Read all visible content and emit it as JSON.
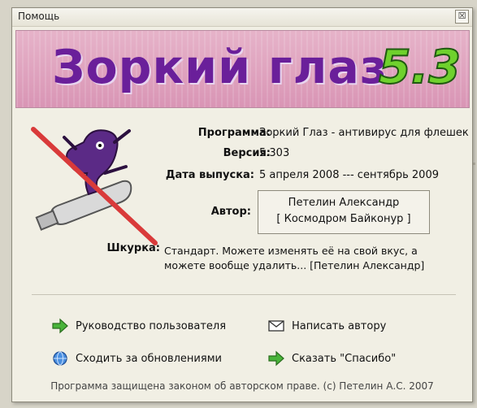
{
  "window": {
    "title": "Помощь",
    "close_glyph": "☒"
  },
  "banner": {
    "title": "Зоркий глаз",
    "version": "5.3"
  },
  "info": {
    "program_label": "Программа:",
    "program_value": "Зоркий Глаз - антивирус для флешек",
    "version_label": "Версия:",
    "version_value": "5.303",
    "release_label": "Дата выпуска:",
    "release_value": "5 апреля 2008  ---  сентябрь 2009",
    "author_label": "Автор:",
    "author_name": "Петелин Александр",
    "author_team": "[ Космодром Байконур ]",
    "skin_label": "Шкурка:",
    "skin_line1": "Стандарт. Можете изменять её на свой вкус, а",
    "skin_line2": "можете вообще удалить... [Петелин Александр]"
  },
  "actions": {
    "manual": "Руководство пользователя",
    "write_author": "Написать автору",
    "updates": "Сходить за обновлениями",
    "thanks": "Сказать \"Спасибо\""
  },
  "footer": {
    "text": "Программа защищена законом об авторском праве. (с) Петелин А.С. 2007"
  },
  "icons": {
    "manual": "green-arrow-icon",
    "write_author": "envelope-icon",
    "updates": "globe-icon",
    "thanks": "green-arrow-icon"
  },
  "colors": {
    "banner_bg": "#d995b5",
    "title_purple": "#6a1f9a",
    "version_green": "#6fd12d",
    "window_bg": "#f1efe4"
  }
}
